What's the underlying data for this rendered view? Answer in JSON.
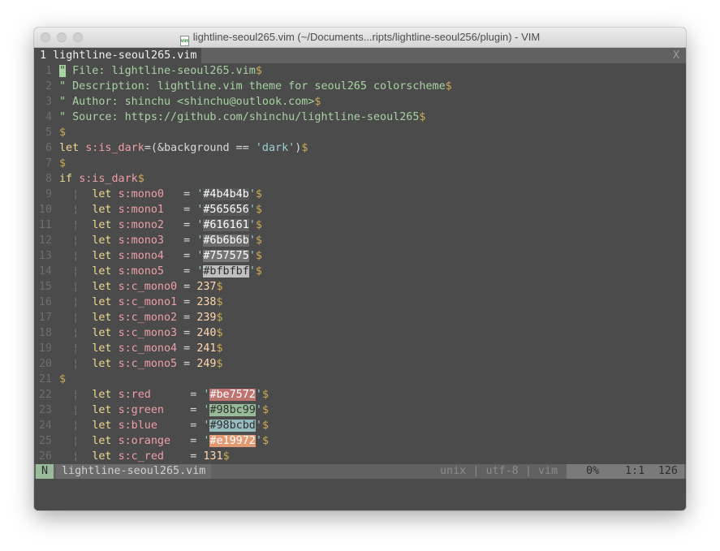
{
  "window": {
    "title": "lightline-seoul265.vim (~/Documents...ripts/lightline-seoul256/plugin) - VIM",
    "file_icon_text": "vim"
  },
  "tabline": {
    "active_tab": "1 lightline-seoul265.vim",
    "close_label": "X"
  },
  "editor": {
    "lines": [
      {
        "n": "1",
        "segs": [
          [
            "cm",
            "\" File: lightline-seoul265.vim"
          ],
          [
            "nt",
            "$"
          ]
        ]
      },
      {
        "n": "2",
        "segs": [
          [
            "cm",
            "\" Description: lightline.vim theme for seoul265 colorscheme"
          ],
          [
            "nt",
            "$"
          ]
        ]
      },
      {
        "n": "3",
        "segs": [
          [
            "cm",
            "\" Author: shinchu <shinchu@outlook.com>"
          ],
          [
            "nt",
            "$"
          ]
        ]
      },
      {
        "n": "4",
        "segs": [
          [
            "cm",
            "\" Source: https://github.com/shinchu/lightline-seoul265"
          ],
          [
            "nt",
            "$"
          ]
        ]
      },
      {
        "n": "5",
        "segs": [
          [
            "nt",
            "$"
          ]
        ]
      },
      {
        "n": "6",
        "segs": [
          [
            "kw",
            "let "
          ],
          [
            "var",
            "s:is_dark"
          ],
          [
            "op",
            "=(&background == "
          ],
          [
            "str",
            "'dark'"
          ],
          [
            "op",
            ")"
          ],
          [
            "nt",
            "$"
          ]
        ]
      },
      {
        "n": "7",
        "segs": [
          [
            "nt",
            "$"
          ]
        ]
      },
      {
        "n": "8",
        "segs": [
          [
            "kw",
            "if "
          ],
          [
            "var",
            "s:is_dark"
          ],
          [
            "nt",
            "$"
          ]
        ]
      },
      {
        "n": "9",
        "segs": [
          [
            "ind",
            "  ¦  "
          ],
          [
            "kw",
            "let "
          ],
          [
            "var",
            "s:mono0"
          ],
          [
            "op",
            "   = "
          ],
          [
            "str",
            "'"
          ],
          [
            "hx",
            "#4b4b4b"
          ],
          [
            "str",
            "'"
          ],
          [
            "nt",
            "$"
          ]
        ]
      },
      {
        "n": "10",
        "segs": [
          [
            "ind",
            "  ¦  "
          ],
          [
            "kw",
            "let "
          ],
          [
            "var",
            "s:mono1"
          ],
          [
            "op",
            "   = "
          ],
          [
            "str",
            "'"
          ],
          [
            "hx",
            "#565656"
          ],
          [
            "str",
            "'"
          ],
          [
            "nt",
            "$"
          ]
        ]
      },
      {
        "n": "11",
        "segs": [
          [
            "ind",
            "  ¦  "
          ],
          [
            "kw",
            "let "
          ],
          [
            "var",
            "s:mono2"
          ],
          [
            "op",
            "   = "
          ],
          [
            "str",
            "'"
          ],
          [
            "hx",
            "#616161"
          ],
          [
            "str",
            "'"
          ],
          [
            "nt",
            "$"
          ]
        ]
      },
      {
        "n": "12",
        "segs": [
          [
            "ind",
            "  ¦  "
          ],
          [
            "kw",
            "let "
          ],
          [
            "var",
            "s:mono3"
          ],
          [
            "op",
            "   = "
          ],
          [
            "str",
            "'"
          ],
          [
            "hx",
            "#6b6b6b"
          ],
          [
            "str",
            "'"
          ],
          [
            "nt",
            "$"
          ]
        ]
      },
      {
        "n": "13",
        "segs": [
          [
            "ind",
            "  ¦  "
          ],
          [
            "kw",
            "let "
          ],
          [
            "var",
            "s:mono4"
          ],
          [
            "op",
            "   = "
          ],
          [
            "str",
            "'"
          ],
          [
            "hx",
            "#757575"
          ],
          [
            "str",
            "'"
          ],
          [
            "nt",
            "$"
          ]
        ]
      },
      {
        "n": "14",
        "segs": [
          [
            "ind",
            "  ¦  "
          ],
          [
            "kw",
            "let "
          ],
          [
            "var",
            "s:mono5"
          ],
          [
            "op",
            "   = "
          ],
          [
            "str",
            "'"
          ],
          [
            "hx",
            "#bfbfbf"
          ],
          [
            "str",
            "'"
          ],
          [
            "nt",
            "$"
          ]
        ]
      },
      {
        "n": "15",
        "segs": [
          [
            "ind",
            "  ¦  "
          ],
          [
            "kw",
            "let "
          ],
          [
            "var",
            "s:c_mono0"
          ],
          [
            "op",
            " = "
          ],
          [
            "num",
            "237"
          ],
          [
            "nt",
            "$"
          ]
        ]
      },
      {
        "n": "16",
        "segs": [
          [
            "ind",
            "  ¦  "
          ],
          [
            "kw",
            "let "
          ],
          [
            "var",
            "s:c_mono1"
          ],
          [
            "op",
            " = "
          ],
          [
            "num",
            "238"
          ],
          [
            "nt",
            "$"
          ]
        ]
      },
      {
        "n": "17",
        "segs": [
          [
            "ind",
            "  ¦  "
          ],
          [
            "kw",
            "let "
          ],
          [
            "var",
            "s:c_mono2"
          ],
          [
            "op",
            " = "
          ],
          [
            "num",
            "239"
          ],
          [
            "nt",
            "$"
          ]
        ]
      },
      {
        "n": "18",
        "segs": [
          [
            "ind",
            "  ¦  "
          ],
          [
            "kw",
            "let "
          ],
          [
            "var",
            "s:c_mono3"
          ],
          [
            "op",
            " = "
          ],
          [
            "num",
            "240"
          ],
          [
            "nt",
            "$"
          ]
        ]
      },
      {
        "n": "19",
        "segs": [
          [
            "ind",
            "  ¦  "
          ],
          [
            "kw",
            "let "
          ],
          [
            "var",
            "s:c_mono4"
          ],
          [
            "op",
            " = "
          ],
          [
            "num",
            "241"
          ],
          [
            "nt",
            "$"
          ]
        ]
      },
      {
        "n": "20",
        "segs": [
          [
            "ind",
            "  ¦  "
          ],
          [
            "kw",
            "let "
          ],
          [
            "var",
            "s:c_mono5"
          ],
          [
            "op",
            " = "
          ],
          [
            "num",
            "249"
          ],
          [
            "nt",
            "$"
          ]
        ]
      },
      {
        "n": "21",
        "segs": [
          [
            "nt",
            "$"
          ]
        ]
      },
      {
        "n": "22",
        "segs": [
          [
            "ind",
            "  ¦  "
          ],
          [
            "kw",
            "let "
          ],
          [
            "var",
            "s:red"
          ],
          [
            "op",
            "      = "
          ],
          [
            "str",
            "'"
          ],
          [
            "hx",
            "#be7572"
          ],
          [
            "str",
            "'"
          ],
          [
            "nt",
            "$"
          ]
        ]
      },
      {
        "n": "23",
        "segs": [
          [
            "ind",
            "  ¦  "
          ],
          [
            "kw",
            "let "
          ],
          [
            "var",
            "s:green"
          ],
          [
            "op",
            "    = "
          ],
          [
            "str",
            "'"
          ],
          [
            "hx",
            "#98bc99"
          ],
          [
            "str",
            "'"
          ],
          [
            "nt",
            "$"
          ]
        ]
      },
      {
        "n": "24",
        "segs": [
          [
            "ind",
            "  ¦  "
          ],
          [
            "kw",
            "let "
          ],
          [
            "var",
            "s:blue"
          ],
          [
            "op",
            "     = "
          ],
          [
            "str",
            "'"
          ],
          [
            "hx",
            "#98bcbd"
          ],
          [
            "str",
            "'"
          ],
          [
            "nt",
            "$"
          ]
        ]
      },
      {
        "n": "25",
        "segs": [
          [
            "ind",
            "  ¦  "
          ],
          [
            "kw",
            "let "
          ],
          [
            "var",
            "s:orange"
          ],
          [
            "op",
            "   = "
          ],
          [
            "str",
            "'"
          ],
          [
            "hx",
            "#e19972"
          ],
          [
            "str",
            "'"
          ],
          [
            "nt",
            "$"
          ]
        ]
      },
      {
        "n": "26",
        "segs": [
          [
            "ind",
            "  ¦  "
          ],
          [
            "kw",
            "let "
          ],
          [
            "var",
            "s:c_red"
          ],
          [
            "op",
            "    = "
          ],
          [
            "num",
            "131"
          ],
          [
            "nt",
            "$"
          ]
        ]
      }
    ]
  },
  "statusline": {
    "mode": "N",
    "filename": "lightline-seoul265.vim",
    "fileformat": "unix",
    "encoding": "utf-8",
    "filetype": "vim",
    "separator": "|",
    "percent": "0%",
    "position": "1:1",
    "total_lines": "126"
  },
  "colors": {
    "background": "#4b4b4b",
    "statusline_bg": "#616161",
    "mode_normal": "#98bc99",
    "comment": "#a6d4a0",
    "keyword": "#f0d88e",
    "variable": "#ef9fa5",
    "string": "#9dd1d6",
    "number": "#ffd7af",
    "nontext": "#ccaa55"
  }
}
